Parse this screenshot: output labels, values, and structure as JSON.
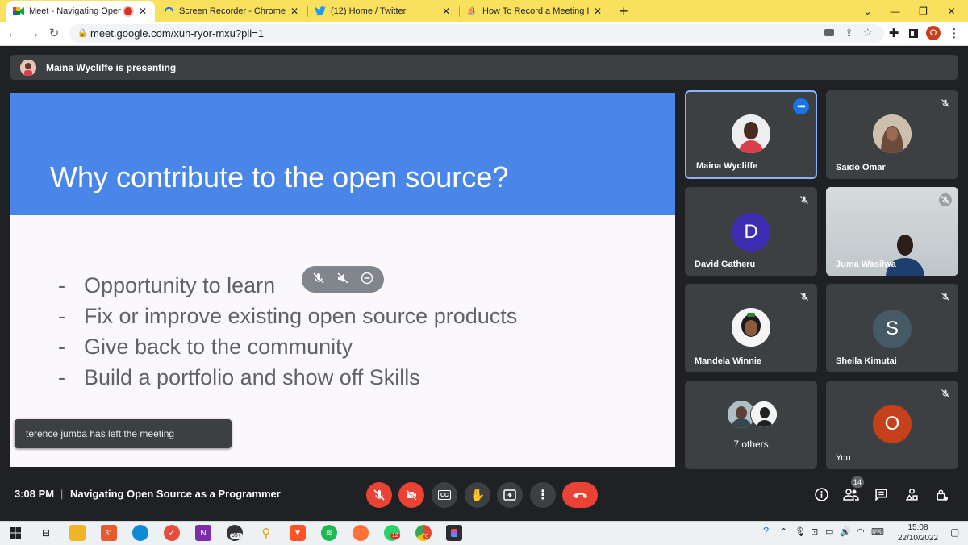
{
  "browser": {
    "tabs": [
      {
        "title": "Meet - Navigating Open Sou",
        "active": true,
        "recording": true
      },
      {
        "title": "Screen Recorder - Chrome Web S",
        "active": false
      },
      {
        "title": "(12) Home / Twitter",
        "active": false
      },
      {
        "title": "How To Record a Meeting In Goo",
        "active": false
      }
    ],
    "new_tab_label": "+",
    "url": "meet.google.com/xuh-ryor-mxu?pli=1",
    "profile_initial": "O"
  },
  "meet": {
    "presenting_text": "Maina Wycliffe is presenting",
    "slide": {
      "title": "Why contribute to the open source?",
      "bullet_marker": "-",
      "bullets": [
        "Opportunity to learn",
        "Fix or improve existing open source products",
        "Give back to the community",
        "Build a portfolio and show off Skills"
      ]
    },
    "toast": "terence jumba has left the meeting",
    "participants": [
      {
        "name": "Maina Wycliffe",
        "active_speaker": true
      },
      {
        "name": "Saido Omar"
      },
      {
        "name": "David Gatheru",
        "initial": "D",
        "color": "#3d2db3"
      },
      {
        "name": "Juma Wasilwa"
      },
      {
        "name": "Mandela Winnie"
      },
      {
        "name": "Sheila Kimutai",
        "initial": "S",
        "color": "#455a64"
      },
      {
        "name": "7 others"
      },
      {
        "name": "You",
        "initial": "O",
        "color": "#c5401b"
      }
    ],
    "time": "3:08 PM",
    "separator": "|",
    "meeting_title": "Navigating Open Source as a Programmer",
    "participant_count": "14"
  },
  "taskbar": {
    "mail_badge": "99+",
    "whatsapp_badge": "12",
    "chrome_badge": "0",
    "calendar_number": "31",
    "time": "15:08",
    "date": "22/10/2022"
  },
  "colors": {
    "tab_strip": "#f9e15e",
    "meet_bg": "#202124",
    "tile_bg": "#3c4043",
    "slide_header": "#4a86e8",
    "danger": "#ea4335"
  }
}
